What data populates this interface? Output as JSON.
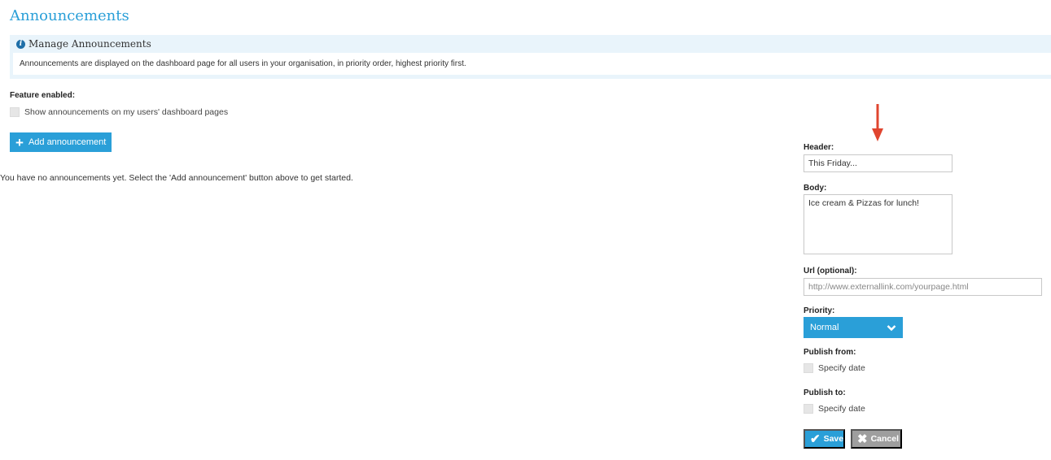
{
  "page": {
    "title": "Announcements"
  },
  "info": {
    "heading": "Manage Announcements",
    "icon_glyph": "i",
    "body": "Announcements are displayed on the dashboard page for all users in your organisation, in priority order, highest priority first."
  },
  "feature": {
    "label": "Feature enabled:",
    "checkbox_label": "Show announcements on my users' dashboard pages"
  },
  "actions": {
    "add_label": "Add announcement",
    "empty_message": "You have no announcements yet. Select the 'Add announcement' button above to get started."
  },
  "form": {
    "header_label": "Header:",
    "header_value": "This Friday...",
    "body_label": "Body:",
    "body_value": "Ice cream & Pizzas for lunch!",
    "url_label": "Url (optional):",
    "url_placeholder": "http://www.externallink.com/yourpage.html",
    "priority_label": "Priority:",
    "priority_value": "Normal",
    "publish_from_label": "Publish from:",
    "publish_from_check": "Specify date",
    "publish_to_label": "Publish to:",
    "publish_to_check": "Specify date",
    "save_label": "Save",
    "cancel_label": "Cancel"
  },
  "colors": {
    "accent": "#2a9fd8",
    "info_bg": "#e9f4fb",
    "arrow": "#e0452f",
    "cancel_bg": "#9e9e9e"
  }
}
